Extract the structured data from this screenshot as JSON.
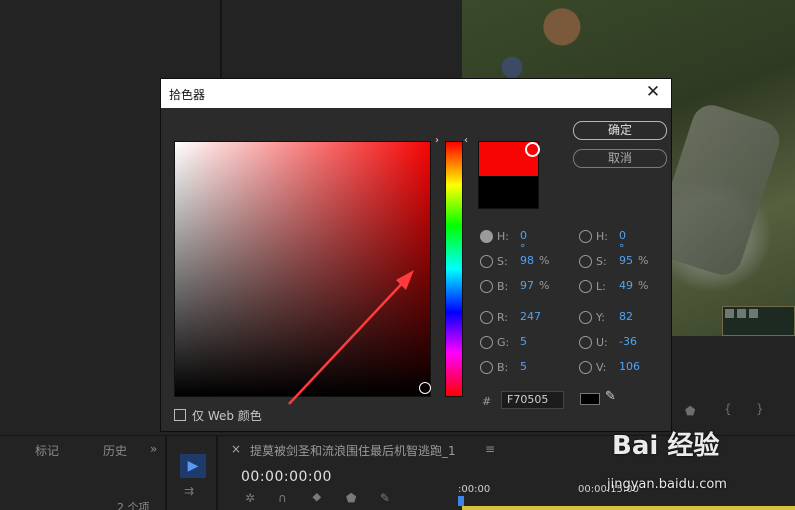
{
  "dialog": {
    "title": "拾色器",
    "ok_label": "确定",
    "cancel_label": "取消",
    "web_colors_label": "仅 Web 颜色",
    "hash_label": "#",
    "hex_value": "F70505"
  },
  "hsb": [
    {
      "label": "H:",
      "value": "0 °",
      "unit": ""
    },
    {
      "label": "S:",
      "value": "98",
      "unit": "%"
    },
    {
      "label": "B:",
      "value": "97",
      "unit": "%"
    }
  ],
  "rgb": [
    {
      "label": "R:",
      "value": "247"
    },
    {
      "label": "G:",
      "value": "5"
    },
    {
      "label": "B:",
      "value": "5"
    }
  ],
  "hsl": [
    {
      "label": "H:",
      "value": "0 °",
      "unit": ""
    },
    {
      "label": "S:",
      "value": "95",
      "unit": "%"
    },
    {
      "label": "L:",
      "value": "49",
      "unit": "%"
    }
  ],
  "yuv": [
    {
      "label": "Y:",
      "value": "82"
    },
    {
      "label": "U:",
      "value": "-36"
    },
    {
      "label": "V:",
      "value": "106"
    }
  ],
  "colors": {
    "selected": "#f70505",
    "previous": "#000000",
    "value_blue": "#4fa3f0"
  },
  "background": {
    "tab_markers": "标记",
    "tab_history": "历史",
    "tab_more": "»",
    "items_count": "2 个项",
    "sequence_close": "×",
    "sequence_title": "提莫被剑圣和流浪围住最后机智逃跑_1",
    "sequence_menu": "≡",
    "timecode": "00:00:00:00",
    "ruler_start": ":00:00",
    "ruler_mid": "00:00:15:00"
  },
  "watermark": {
    "brand": "Bai 经验",
    "url": "jingyan.baidu.com"
  }
}
